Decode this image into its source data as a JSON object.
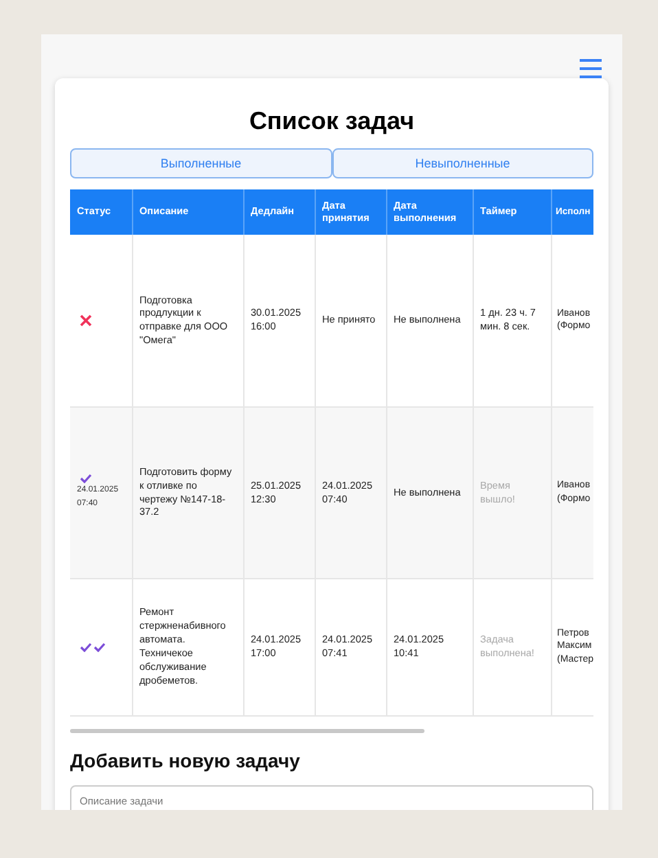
{
  "title": "Список задач",
  "tabs": [
    {
      "label": "Выполненные",
      "selected": false
    },
    {
      "label": "Невыполненные",
      "selected": false
    }
  ],
  "table": {
    "columns": [
      "Статус",
      "Описание",
      "Дедлайн",
      "Дата принятия",
      "Дата выполнения",
      "Таймер",
      "Исполн"
    ],
    "rows": [
      {
        "status": {
          "kind": "cross"
        },
        "description": "Подготовка продлукции к отправке для ООО \"Омега\"",
        "deadline": "30.01.2025 16:00",
        "accepted": "Не принято",
        "completed": "Не выполнена",
        "timer": {
          "text": "1 дн. 23 ч. 7 мин. 8 сек.",
          "muted": false
        },
        "assignee": "Иванов (Формо"
      },
      {
        "status": {
          "kind": "check",
          "date": "24.01.2025 07:40"
        },
        "description": "Подготовить форму к отливке по чертежу №147-18-37.2",
        "deadline": "25.01.2025 12:30",
        "accepted": "24.01.2025 07:40",
        "completed": "Не выполнена",
        "timer": {
          "text": "Время вышло!",
          "muted": true
        },
        "assignee": "Иванов (Формо"
      },
      {
        "status": {
          "kind": "double-check"
        },
        "description": "Ремонт стержненабивного автомата. Техничекое обслуживание дробеметов.",
        "deadline": "24.01.2025 17:00",
        "accepted": "24.01.2025 07:41",
        "completed": "24.01.2025 10:41",
        "timer": {
          "text": "Задача выполнена!",
          "muted": true
        },
        "assignee": "Петров Максим (Мастер"
      }
    ]
  },
  "add_section": {
    "heading": "Добавить новую задачу",
    "description_field": {
      "placeholder": "Описание задачи"
    }
  }
}
